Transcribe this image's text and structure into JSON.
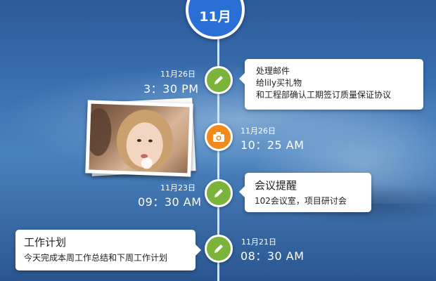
{
  "header": {
    "month": "11月"
  },
  "events": [
    {
      "date": "11月26日",
      "time": "3：30 PM",
      "icon": "pencil-icon",
      "lines": [
        "处理邮件",
        "给lily买礼物",
        "和工程部确认工期签订质量保证协议"
      ]
    },
    {
      "date": "11月26日",
      "time": "10：25 AM",
      "icon": "camera-icon"
    },
    {
      "date": "11月23日",
      "time": "09：30 AM",
      "icon": "pencil-icon",
      "title": "会议提醒",
      "subtitle": "102会议室，项目研讨会"
    },
    {
      "date": "11月21日",
      "time": "08：30 AM",
      "icon": "pencil-icon",
      "title": "工作计划",
      "subtitle": "今天完成本周工作总结和下周工作计划"
    }
  ],
  "colors": {
    "badge": "#2a6fd6",
    "node_green": "#7cb33a",
    "node_orange": "#f08a1a",
    "line": "#d9e3ee"
  }
}
